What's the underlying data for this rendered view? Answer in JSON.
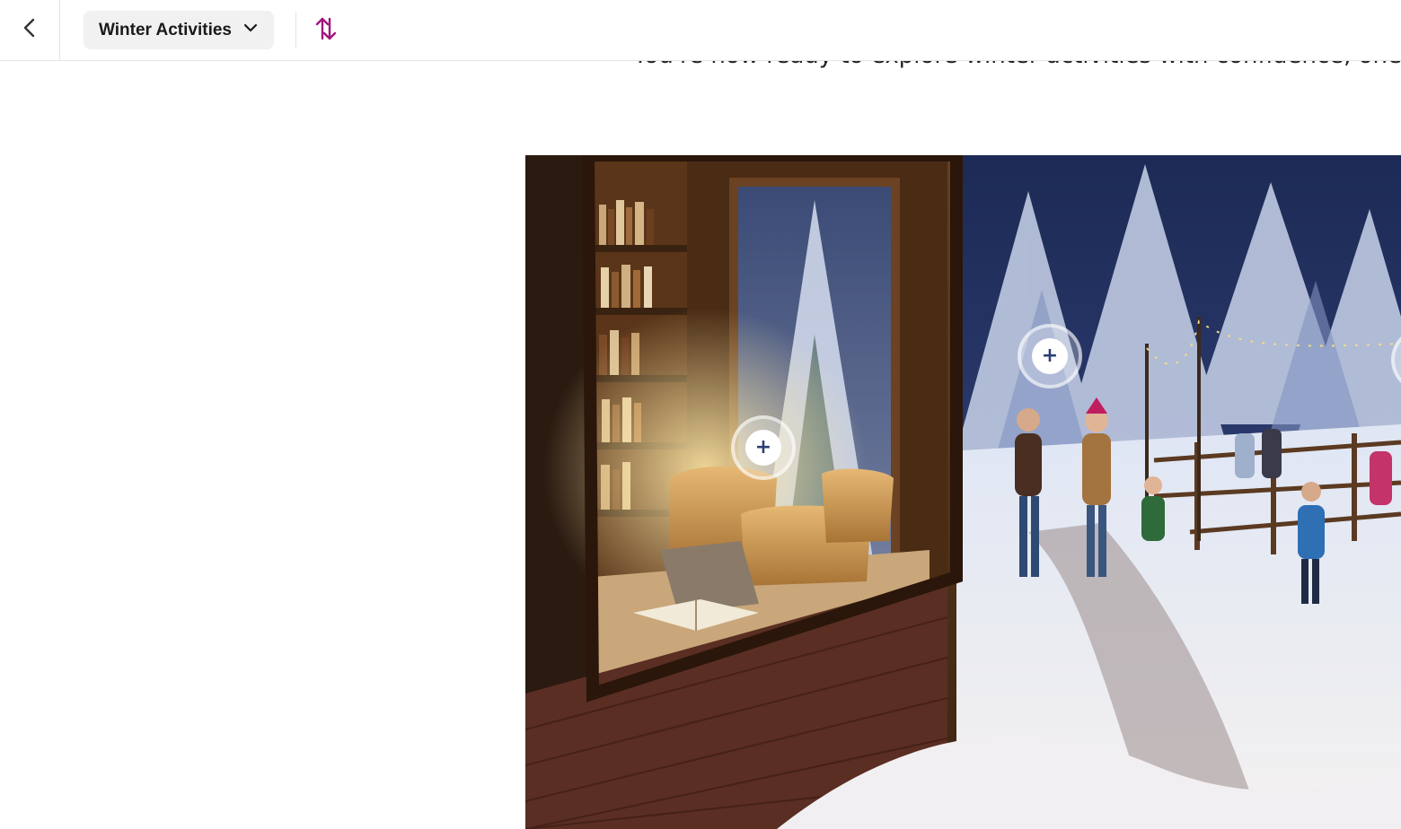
{
  "header": {
    "back_icon": "chevron-left-icon",
    "topic_selector": {
      "label": "Winter Activities",
      "icon": "chevron-down-icon"
    },
    "reorder_icon": "swap-vertical-icon",
    "accent_color": "#a0157e"
  },
  "content": {
    "intro_text": "You're now ready to explore winter activities with confidence, one seaso",
    "scene_image": {
      "hotspots": [
        {
          "symbol": "+"
        },
        {
          "symbol": "+"
        },
        {
          "symbol": "+"
        }
      ]
    }
  }
}
